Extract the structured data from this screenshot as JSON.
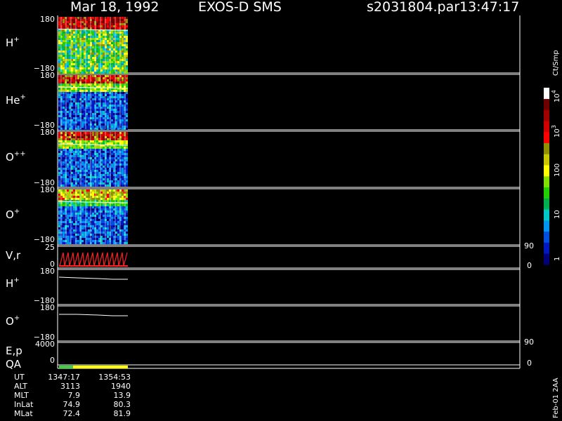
{
  "header": {
    "date": "Mar 18, 1992",
    "instrument": "EXOS-D SMS",
    "file": "s2031804.par",
    "time": "13:47:17"
  },
  "colorbar": {
    "unit": "Ct/Smp",
    "labels": [
      "1",
      "10",
      "100",
      "10",
      "10"
    ],
    "exponents": [
      "",
      "",
      "",
      "3",
      "4"
    ],
    "colors": [
      "#00007a",
      "#0018c0",
      "#0050e0",
      "#0096f0",
      "#00c8c8",
      "#00b050",
      "#20d000",
      "#80e000",
      "#ffff00",
      "#c8c800",
      "#909000",
      "#ff0000",
      "#d00000",
      "#a00000",
      "#700000",
      "#ffffff"
    ]
  },
  "chart_data": {
    "type": "heatmap",
    "x_range_ut": [
      "1347:17",
      "1354:53"
    ],
    "panels": [
      {
        "id": "h-plus",
        "label": "H",
        "sup": "+",
        "ytop": "180",
        "ybot": "−180"
      },
      {
        "id": "he-plus",
        "label": "He",
        "sup": "+",
        "ytop": "180",
        "ybot": "−180"
      },
      {
        "id": "o-plusplus",
        "label": "O",
        "sup": "++",
        "ytop": "180",
        "ybot": "−180"
      },
      {
        "id": "o-plus",
        "label": "O",
        "sup": "+",
        "ytop": "180",
        "ybot": "−180"
      }
    ],
    "vr_panel": {
      "label": "V,r",
      "ytop": "25",
      "ybot": "0",
      "right_top": "90",
      "right_bot": "0"
    },
    "line_panels": [
      {
        "id": "h-plus-line",
        "label": "H",
        "sup": "+",
        "ytop": "180",
        "ybot": "−180"
      },
      {
        "id": "o-plus-line",
        "label": "O",
        "sup": "+",
        "ytop": "180",
        "ybot": "−180"
      }
    ],
    "ep_panel": {
      "label": "E,p",
      "ytop": "4000",
      "ybot": "0",
      "right_top": "90",
      "right_bot": "0"
    },
    "qa_panel": {
      "label": "QA"
    }
  },
  "info_table": {
    "rows": [
      {
        "label": "UT",
        "v1": "1347:17",
        "v2": "1354:53"
      },
      {
        "label": "ALT",
        "v1": "3113",
        "v2": "1940"
      },
      {
        "label": "MLT",
        "v1": "7.9",
        "v2": "13.9"
      },
      {
        "label": "InLat",
        "v1": "74.9",
        "v2": "80.3"
      },
      {
        "label": "MLat",
        "v1": "72.4",
        "v2": "81.9"
      }
    ]
  },
  "footer_stamp": "Feb-01 2AA"
}
